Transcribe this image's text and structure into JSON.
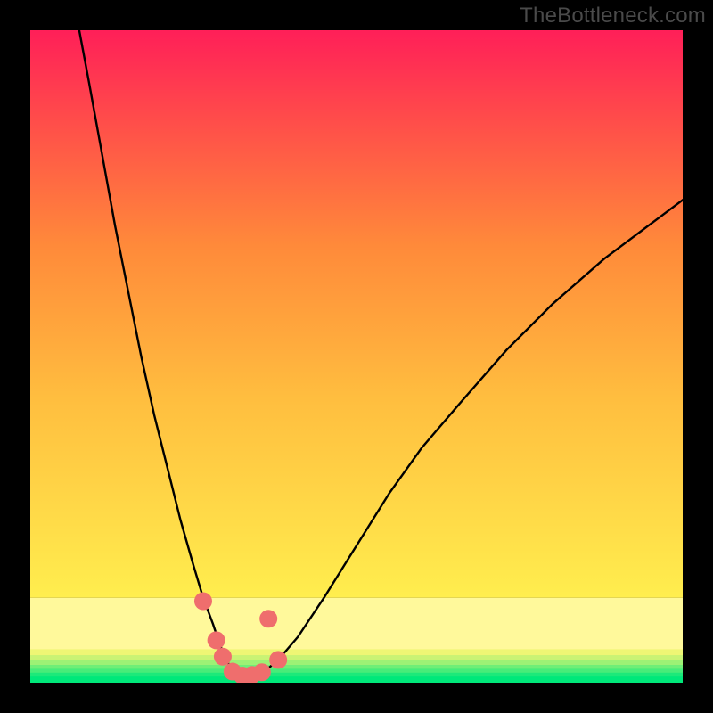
{
  "watermark": "TheBottleneck.com",
  "chart_data": {
    "type": "line",
    "title": "",
    "xlabel": "",
    "ylabel": "",
    "xlim": [
      0,
      100
    ],
    "ylim": [
      0,
      100
    ],
    "grid": false,
    "series": [
      {
        "name": "bottleneck-curve",
        "x": [
          7.5,
          9,
          11,
          13,
          15,
          17,
          19,
          21,
          23,
          25,
          26.5,
          28,
          29,
          30,
          31,
          32,
          33,
          34.5,
          36,
          38,
          41,
          45,
          50,
          55,
          60,
          66,
          73,
          80,
          88,
          96,
          100
        ],
        "y": [
          100,
          92,
          81,
          70,
          60,
          50,
          41,
          33,
          25,
          18,
          13,
          9,
          6,
          3.5,
          2,
          1.2,
          1,
          1.1,
          1.8,
          3.5,
          7,
          13,
          21,
          29,
          36,
          43,
          51,
          58,
          65,
          71,
          74
        ]
      }
    ],
    "markers": [
      {
        "name": "curve-points",
        "x": [
          26.5,
          28.5,
          29.5,
          31,
          32.5,
          34,
          35.5,
          36.5,
          38
        ],
        "y": [
          12.5,
          6.5,
          4,
          1.7,
          1.1,
          1.2,
          1.6,
          9.8,
          3.5
        ]
      }
    ],
    "bands": [
      {
        "y0": 0.0,
        "y1": 1.0,
        "color": "#00e87a"
      },
      {
        "y0": 1.0,
        "y1": 1.6,
        "color": "#1de97a"
      },
      {
        "y0": 1.6,
        "y1": 2.2,
        "color": "#48ec79"
      },
      {
        "y0": 2.2,
        "y1": 2.8,
        "color": "#6fee77"
      },
      {
        "y0": 2.8,
        "y1": 3.5,
        "color": "#9df175"
      },
      {
        "y0": 3.5,
        "y1": 4.3,
        "color": "#c9f374"
      },
      {
        "y0": 4.3,
        "y1": 5.2,
        "color": "#eef674"
      },
      {
        "y0": 5.2,
        "y1": 13.0,
        "color": "#fff99b"
      }
    ],
    "gradient_upper": {
      "from_y": 13.0,
      "to_y": 100.0,
      "stops": [
        {
          "t": 0.0,
          "color": "#ffee4e"
        },
        {
          "t": 0.35,
          "color": "#ffbe3f"
        },
        {
          "t": 0.62,
          "color": "#ff8a3a"
        },
        {
          "t": 0.84,
          "color": "#ff4d4a"
        },
        {
          "t": 1.0,
          "color": "#ff1f58"
        }
      ]
    }
  }
}
